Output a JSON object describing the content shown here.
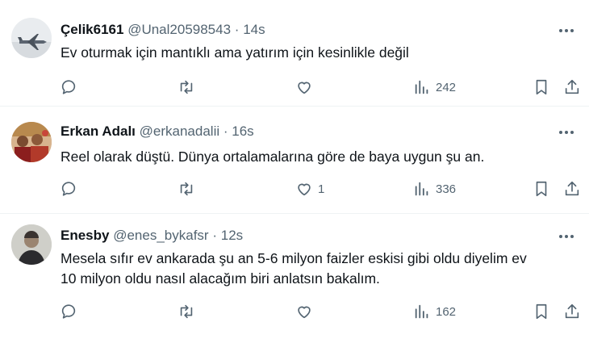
{
  "tweets": [
    {
      "name": "Çelik6161",
      "handle": "@Unal20598543",
      "dot": "·",
      "time": "14s",
      "text_lines": [
        "Ev oturmak için mantıklı ama yatırım için kesinlikle değil"
      ],
      "likes": "",
      "views": "242",
      "avatar": "jet-photo"
    },
    {
      "name": "Erkan Adalı",
      "handle": "@erkanadalii",
      "dot": "·",
      "time": "16s",
      "text_lines": [
        "Reel olarak düştü. Dünya ortalamalarına göre de baya uygun şu an."
      ],
      "likes": "1",
      "views": "336",
      "avatar": "people-photo"
    },
    {
      "name": "Enesby",
      "handle": "@enes_bykafsr",
      "dot": "·",
      "time": "12s",
      "text_lines": [
        "Mesela sıfır ev ankarada şu an 5-6 milyon faizler eskisi gibi oldu diyelim ev",
        "10 milyon oldu nasıl alacağım biri anlatsın bakalım."
      ],
      "likes": "",
      "views": "162",
      "avatar": "person-photo"
    }
  ],
  "icons": {
    "more": "more-horizontal-icon",
    "reply": "reply-icon",
    "retweet": "retweet-icon",
    "like": "like-icon",
    "views": "views-icon",
    "bookmark": "bookmark-icon",
    "share": "share-icon"
  },
  "colors": {
    "text": "#0f1419",
    "secondary": "#536471",
    "divider": "#eff3f4"
  }
}
